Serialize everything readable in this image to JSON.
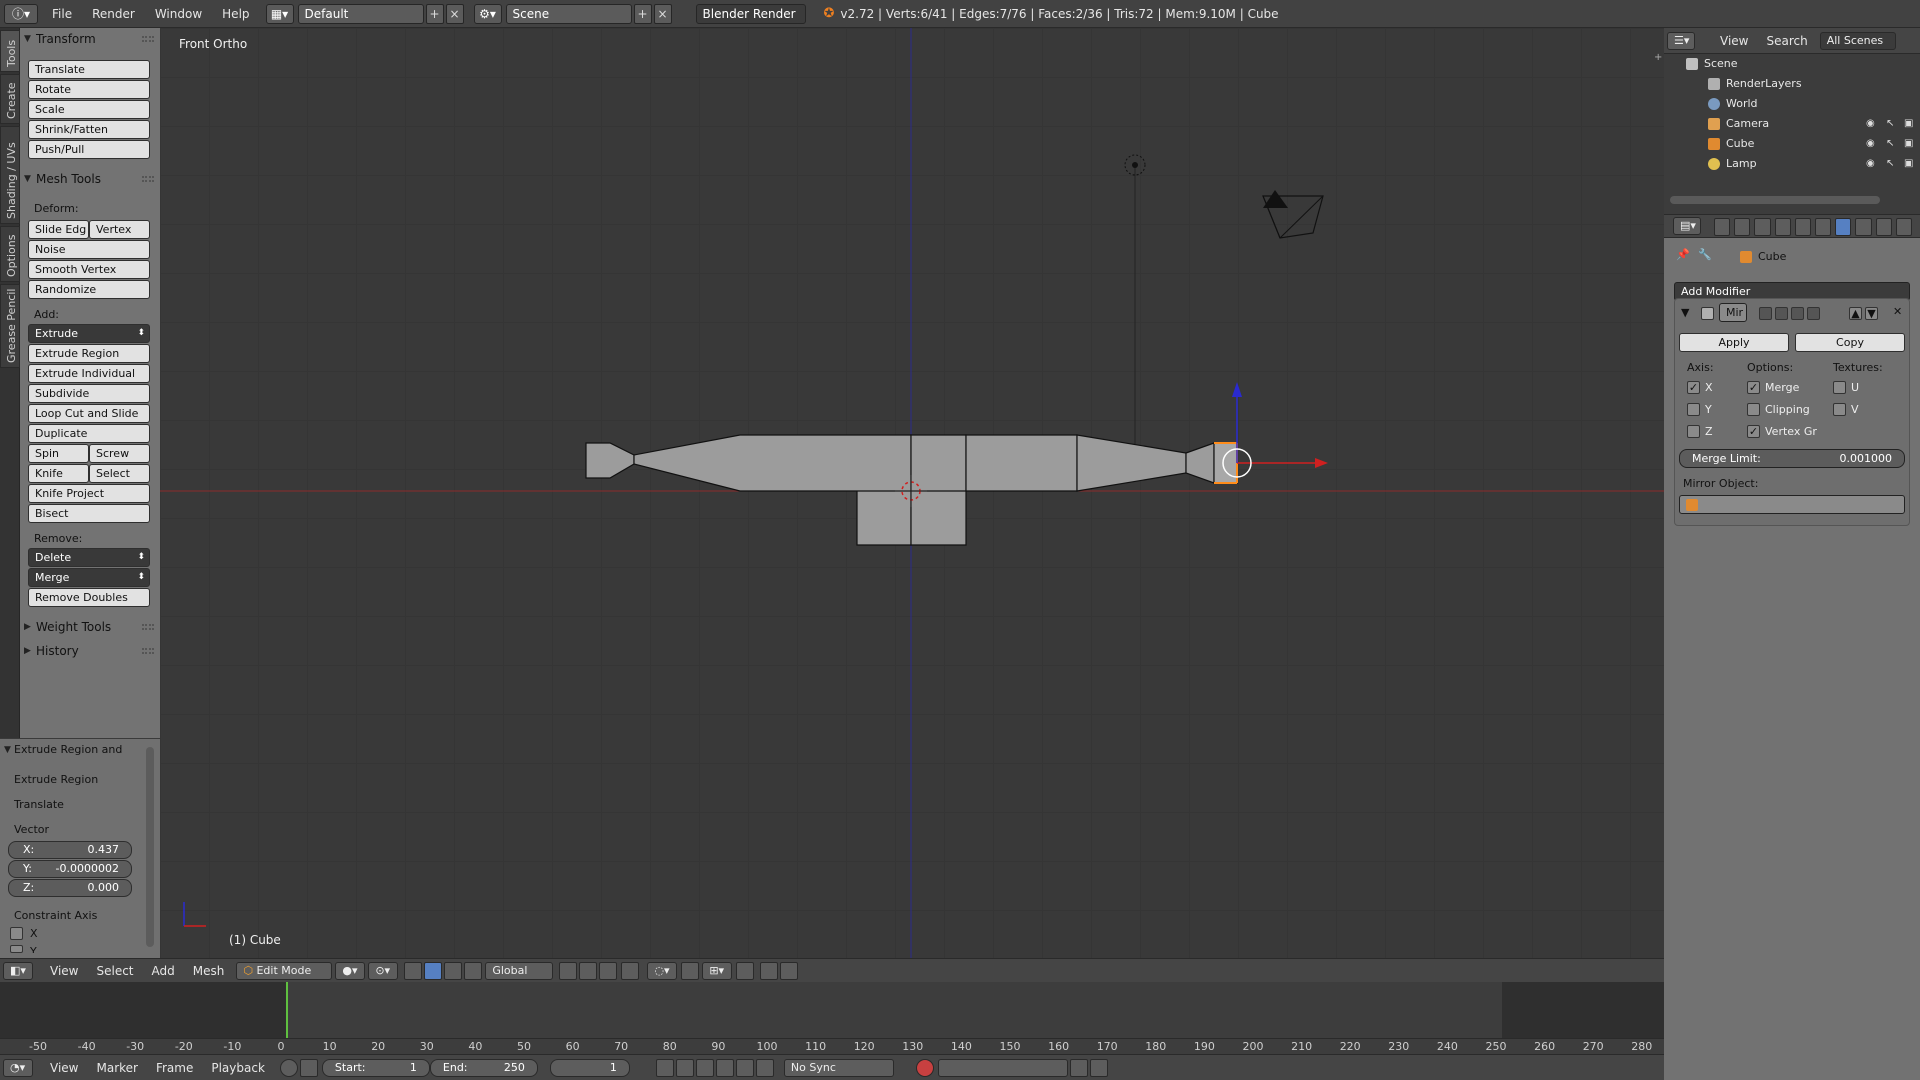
{
  "topbar": {
    "menus": [
      "File",
      "Render",
      "Window",
      "Help"
    ],
    "layout": "Default",
    "scene": "Scene",
    "engine": "Blender Render",
    "stats": "v2.72 | Verts:6/41 | Edges:7/76 | Faces:2/36 | Tris:72 | Mem:9.10M | Cube"
  },
  "lefttabs": [
    "Tools",
    "Create",
    "Shading / UVs",
    "Options",
    "Grease Pencil"
  ],
  "toolshelf": {
    "transform": {
      "title": "Transform",
      "buttons": [
        "Translate",
        "Rotate",
        "Scale",
        "Shrink/Fatten",
        "Push/Pull"
      ]
    },
    "mesh_tools": {
      "title": "Mesh Tools",
      "deform_label": "Deform:",
      "slide_edge": "Slide Edg",
      "vertex": "Vertex",
      "noise": "Noise",
      "smooth_vertex": "Smooth Vertex",
      "randomize": "Randomize",
      "add_label": "Add:",
      "extrude": "Extrude",
      "extrude_region": "Extrude Region",
      "extrude_individual": "Extrude Individual",
      "subdivide": "Subdivide",
      "loop_cut": "Loop Cut and Slide",
      "duplicate": "Duplicate",
      "spin": "Spin",
      "screw": "Screw",
      "knife": "Knife",
      "select": "Select",
      "knife_project": "Knife Project",
      "bisect": "Bisect",
      "remove_label": "Remove:",
      "delete": "Delete",
      "merge": "Merge",
      "remove_doubles": "Remove Doubles"
    },
    "weight_tools": "Weight Tools",
    "history": "History"
  },
  "operator": {
    "title": "Extrude Region and",
    "extrude_region": "Extrude Region",
    "translate": "Translate",
    "vector_label": "Vector",
    "x_label": "X:",
    "x_value": "0.437",
    "y_label": "Y:",
    "y_value": "-0.0000002",
    "z_label": "Z:",
    "z_value": "0.000",
    "constraint_label": "Constraint Axis",
    "cx": "X",
    "cy": "Y"
  },
  "viewport": {
    "view_name": "Front Ortho",
    "object_name": "(1) Cube"
  },
  "vpheader": {
    "menus": [
      "View",
      "Select",
      "Add",
      "Mesh"
    ],
    "mode": "Edit Mode",
    "orientation": "Global"
  },
  "timeline": {
    "ticks": [
      "-50",
      "-40",
      "-30",
      "-20",
      "-10",
      "0",
      "10",
      "20",
      "30",
      "40",
      "50",
      "60",
      "70",
      "80",
      "90",
      "100",
      "110",
      "120",
      "130",
      "140",
      "150",
      "160",
      "170",
      "180",
      "190",
      "200",
      "210",
      "220",
      "230",
      "240",
      "250",
      "260",
      "270",
      "280"
    ],
    "current_frame": 0
  },
  "bottombar": {
    "menus": [
      "View",
      "Marker",
      "Frame",
      "Playback"
    ],
    "start_label": "Start:",
    "start_value": "1",
    "end_label": "End:",
    "end_value": "250",
    "frame_value": "1",
    "sync": "No Sync"
  },
  "outliner": {
    "menus": [
      "View",
      "Search"
    ],
    "filter": "All Scenes",
    "items": [
      "Scene",
      "RenderLayers",
      "World",
      "Camera",
      "Cube",
      "Lamp"
    ]
  },
  "properties": {
    "object": "Cube",
    "add_modifier": "Add Modifier",
    "modifier_name": "Mir",
    "apply": "Apply",
    "copy": "Copy",
    "axis_label": "Axis:",
    "options_label": "Options:",
    "textures_label": "Textures:",
    "ax_x": "X",
    "ax_y": "Y",
    "ax_z": "Z",
    "opt_merge": "Merge",
    "opt_clipping": "Clipping",
    "opt_vertex_groups": "Vertex Gr",
    "tex_u": "U",
    "tex_v": "V",
    "merge_limit_label": "Merge Limit:",
    "merge_limit_value": "0.001000",
    "mirror_object_label": "Mirror Object:"
  },
  "colors": {
    "x_axis": "#d02020",
    "z_axis": "#2a2ad0",
    "selection": "#ff8c1a",
    "mesh_face": "#9a9a9a"
  }
}
